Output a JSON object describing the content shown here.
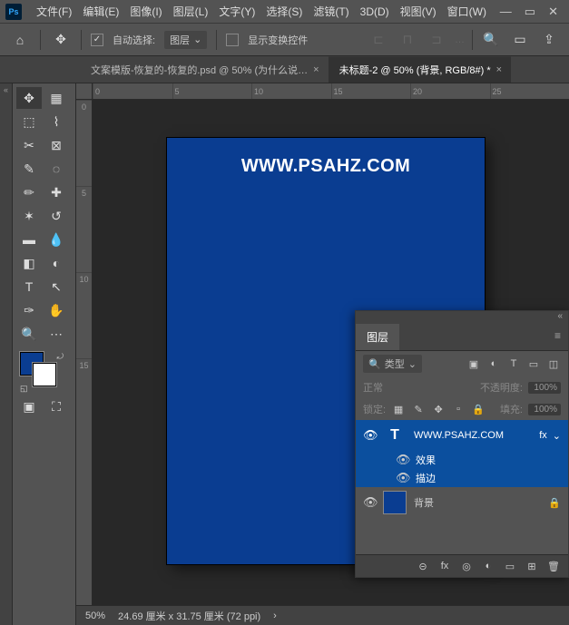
{
  "menus": [
    "文件(F)",
    "编辑(E)",
    "图像(I)",
    "图层(L)",
    "文字(Y)",
    "选择(S)",
    "滤镜(T)",
    "3D(D)",
    "视图(V)",
    "窗口(W)"
  ],
  "ps_logo": "Ps",
  "options": {
    "auto_select": "自动选择:",
    "target": "图层",
    "show_transform": "显示变换控件"
  },
  "tabs": [
    {
      "label": "文案模版-恢复的-恢复的.psd @ 50% (为什么说…",
      "active": false
    },
    {
      "label": "未标题-2 @ 50% (背景, RGB/8#) *",
      "active": true
    }
  ],
  "ruler_h": [
    "0",
    "5",
    "10",
    "15",
    "20",
    "25"
  ],
  "ruler_v": [
    "0",
    "5",
    "10",
    "15"
  ],
  "canvas_text": "WWW.PSAHZ.COM",
  "status": {
    "zoom": "50%",
    "info": "24.69 厘米 x 31.75 厘米 (72 ppi)"
  },
  "panel": {
    "title": "图层",
    "filter_label": "类型",
    "blend_mode": "正常",
    "opacity_label": "不透明度:",
    "opacity_value": "100%",
    "lock_label": "锁定:",
    "fill_label": "填充:",
    "fill_value": "100%",
    "layers": [
      {
        "name": "WWW.PSAHZ.COM",
        "type": "text",
        "selected": true,
        "fx": "fx"
      },
      {
        "name": "背景",
        "type": "bg",
        "selected": false,
        "lock": "🔒"
      }
    ],
    "sub_effects": "效果",
    "sub_stroke": "描边"
  }
}
